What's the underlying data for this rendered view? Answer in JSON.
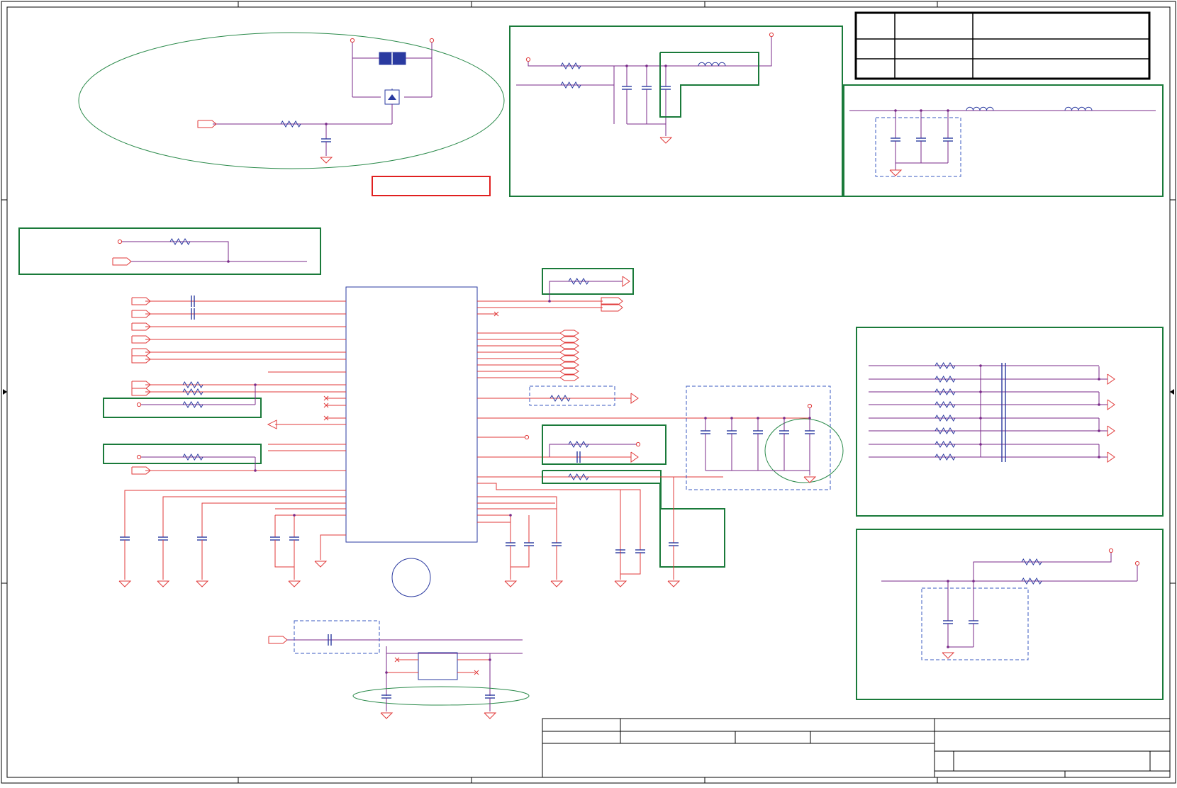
{
  "colors": {
    "wire": "#e03a3a",
    "net": "#7a2a8a",
    "component": "#2a3aa0",
    "highlight_box": "#1a7a3a",
    "warning_box": "#e02020",
    "ellipse": "#2a8a4a",
    "frame": "#000000",
    "dashed_group": "#3a5ac0"
  },
  "icons": {
    "resistor": "resistor-icon",
    "capacitor": "capacitor-icon",
    "inductor": "inductor-icon",
    "ground": "ground-icon",
    "net_port": "net-port-icon",
    "test_point": "test-point-icon",
    "no_connect": "no-connect-icon",
    "crystal": "crystal-icon",
    "diode": "diode-icon"
  },
  "title_block": {},
  "revision_table": {}
}
